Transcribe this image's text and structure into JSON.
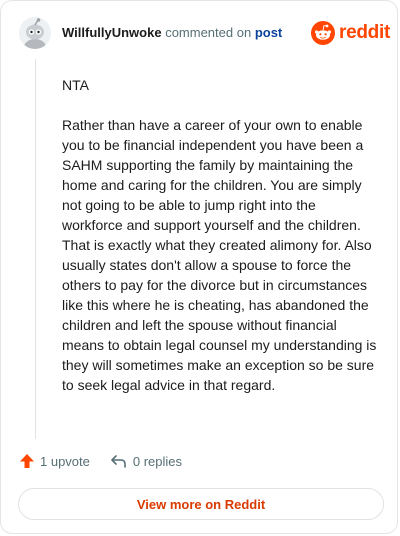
{
  "header": {
    "username": "WillfullyUnwoke",
    "commented_text": "commented on",
    "post_link": "post"
  },
  "logo": {
    "word": "reddit",
    "icon": "reddit-snoo-icon",
    "color": "#ff4500"
  },
  "comment": {
    "paragraphs": [
      "NTA",
      "Rather than have a career of your own to enable you to be financial independent you have been a SAHM supporting the family by maintaining the home and caring for the children. You are simply not going to be able to jump right into the workforce and support yourself and the children. That is exactly what they created alimony for. Also usually states don't allow a spouse to force the others to pay for the divorce but in circumstances like this where he is cheating, has abandoned the children and left the spouse without financial means to obtain legal counsel my understanding is they will sometimes make an exception so be sure to seek legal advice in that regard."
    ]
  },
  "actions": {
    "upvote_label": "1 upvote",
    "upvote_icon": "upvote-arrow-icon",
    "replies_label": "0 replies",
    "reply_icon": "reply-arrow-icon"
  },
  "view_more_label": "View more on Reddit",
  "colors": {
    "accent": "#ff4500",
    "link": "#0a449b",
    "button_text": "#d93a00"
  }
}
